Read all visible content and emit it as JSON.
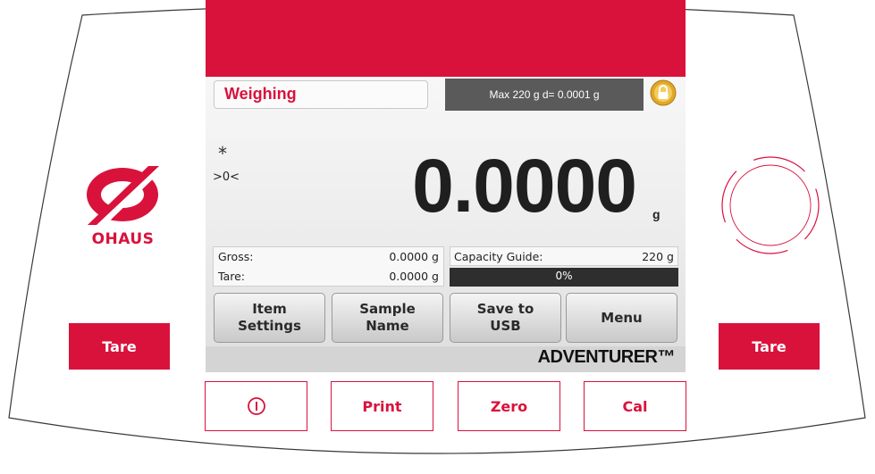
{
  "brand": {
    "logo_text": "OHAUS",
    "model": "ADVENTURER™",
    "accent_color": "#d9123c"
  },
  "display": {
    "mode_label": "Weighing",
    "spec": "Max 220 g  d= 0.0001 g",
    "stable_symbol": "*",
    "center_zero": ">0<",
    "weight": "0.0000",
    "unit": "g",
    "gross": {
      "label": "Gross:",
      "value": "0.0000 g"
    },
    "tare": {
      "label": "Tare:",
      "value": "0.0000 g"
    },
    "capacity_guide": {
      "label": "Capacity Guide:",
      "value": "220 g",
      "percent_text": "0%",
      "fraction": 0
    },
    "softkeys": [
      {
        "label": "Item\nSettings"
      },
      {
        "label": "Sample\nName"
      },
      {
        "label": "Save to\nUSB"
      },
      {
        "label": "Menu"
      }
    ],
    "lock_icon": "lock-icon"
  },
  "keys": {
    "tare_left": "Tare",
    "tare_right": "Tare",
    "power_icon": "power-icon",
    "print": "Print",
    "zero": "Zero",
    "cal": "Cal"
  }
}
